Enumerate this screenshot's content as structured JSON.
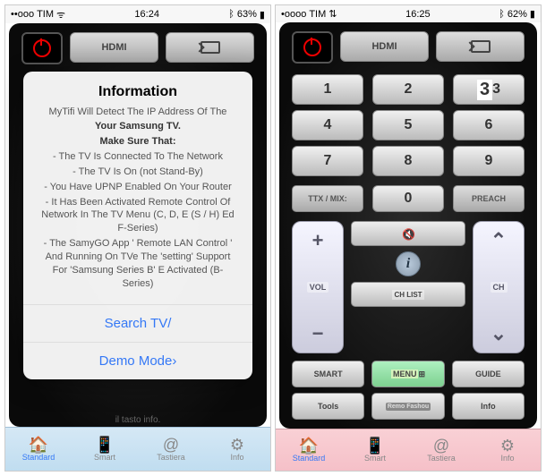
{
  "status": {
    "carrier": "TIM",
    "time_left": "16:24",
    "time_right": "16:25",
    "batt_left": "63%",
    "batt_right": "62%"
  },
  "toprow": {
    "hdmi": "HDMI"
  },
  "numpad": [
    "1",
    "2",
    "3",
    "4",
    "5",
    "6",
    "7",
    "8",
    "9"
  ],
  "row4": {
    "ttx": "TTX / MIX:",
    "zero": "0",
    "prech": "PREACH"
  },
  "rocker": {
    "vol": "VOL",
    "ch": "CH",
    "plus": "+",
    "minus": "−",
    "up": "⌃",
    "down": "⌄"
  },
  "center": {
    "chlist": "CH LIST",
    "info": "i"
  },
  "botrow": {
    "smart": "SMART",
    "menu": "MENU",
    "guide": "GUIDE",
    "tools": "Tools",
    "remo": "Remo\nFashou",
    "info": "Info"
  },
  "tabs": {
    "standard_l": "Standard",
    "smart": "Smart",
    "standard_r": "Standard",
    "tastiera": "Tastiera",
    "info": "Info"
  },
  "modal": {
    "title": "Information",
    "l1": "MyTifi Will Detect The IP Address Of The",
    "l2": "Your Samsung TV.",
    "l3": "Make Sure That:",
    "l4": "- The TV Is Connected To The Network",
    "l5": "- The TV Is On (not Stand-By)",
    "l6": "- You Have UPNP Enabled On Your Router",
    "l7": "- It Has Been Activated Remote Control Of Network In The TV Menu (C, D, E (S / H) Ed F-Series)",
    "l8": "- The SamyGO App ' Remote LAN Control ' And Running On TVe The 'setting' Support For 'Samsung Series B' E Activated (B-Series)",
    "btn_search": "Search TV/",
    "btn_demo": "Demo Mode›",
    "hint": "il tasto info."
  }
}
